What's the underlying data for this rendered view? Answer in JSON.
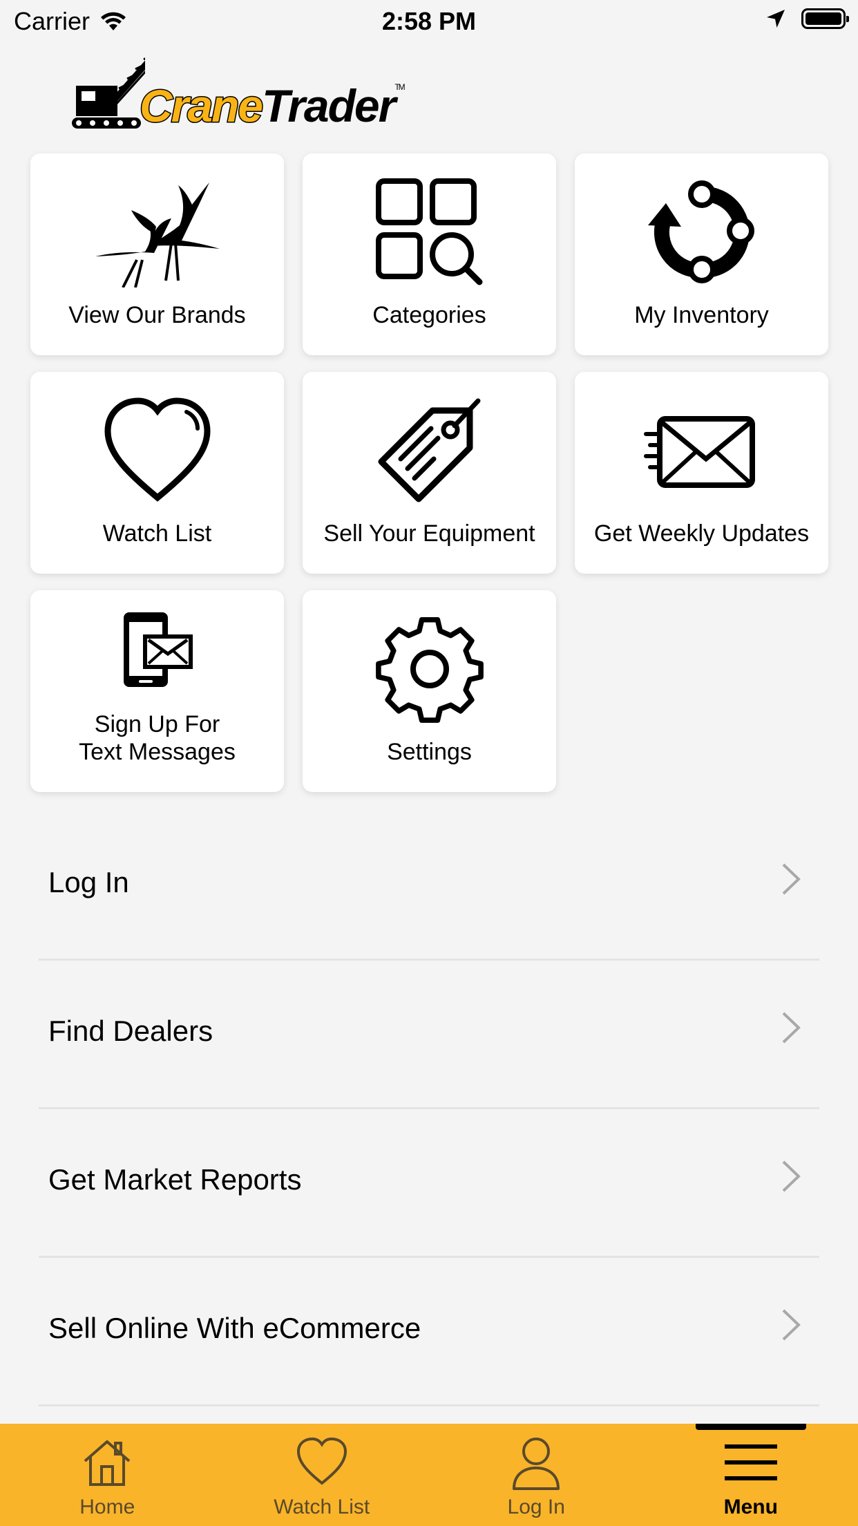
{
  "status_bar": {
    "carrier": "Carrier",
    "time": "2:58 PM"
  },
  "logo": {
    "word_crane": "Crane",
    "word_trader": "Trader",
    "tm": "TM"
  },
  "tiles": [
    {
      "label": "View Our Brands",
      "icon": "cranes-birds-icon"
    },
    {
      "label": "Categories",
      "icon": "categories-grid-search-icon"
    },
    {
      "label": "My Inventory",
      "icon": "inventory-cycle-icon"
    },
    {
      "label": "Watch List",
      "icon": "heart-icon"
    },
    {
      "label": "Sell Your Equipment",
      "icon": "price-tag-icon"
    },
    {
      "label": "Get Weekly Updates",
      "icon": "envelope-fast-icon"
    },
    {
      "label": "Sign Up For\nText Messages",
      "icon": "phone-message-icon"
    },
    {
      "label": "Settings",
      "icon": "gear-icon"
    }
  ],
  "menu": [
    {
      "label": "Log In"
    },
    {
      "label": "Find Dealers"
    },
    {
      "label": "Get Market Reports"
    },
    {
      "label": "Sell Online With eCommerce"
    }
  ],
  "tab_bar": {
    "tabs": [
      {
        "label": "Home",
        "icon": "home-icon"
      },
      {
        "label": "Watch List",
        "icon": "heart-icon"
      },
      {
        "label": "Log In",
        "icon": "person-icon"
      },
      {
        "label": "Menu",
        "icon": "hamburger-menu-icon"
      }
    ],
    "active": "Menu"
  },
  "colors": {
    "accent": "#f9b42a",
    "logo_yellow": "#f9b316",
    "background": "#f4f4f4",
    "tile": "#ffffff"
  }
}
